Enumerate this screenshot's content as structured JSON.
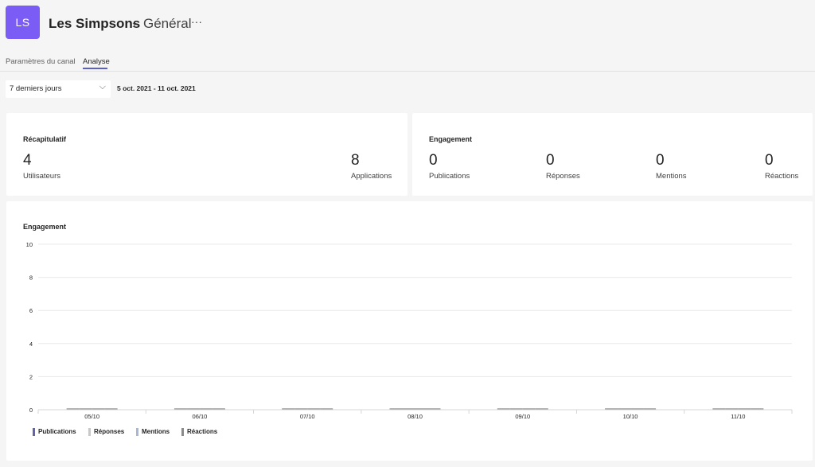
{
  "header": {
    "avatar_initials": "LS",
    "avatar_color": "#7b5cf5",
    "team_name": "Les Simpsons",
    "separator": "›",
    "channel_name": "Général",
    "more": "···"
  },
  "tabs": [
    {
      "label": "Paramètres du canal",
      "active": false
    },
    {
      "label": "Analyse",
      "active": true
    }
  ],
  "accent_color": "#5b5fc7",
  "filter": {
    "period": "7 derniers jours",
    "date_range": "5 oct. 2021 - 11 oct. 2021"
  },
  "summary": {
    "title": "Récapitulatif",
    "stats": [
      {
        "value": "4",
        "label": "Utilisateurs"
      },
      {
        "value": "8",
        "label": "Applications"
      }
    ]
  },
  "engagement": {
    "title": "Engagement",
    "stats": [
      {
        "value": "0",
        "label": "Publications"
      },
      {
        "value": "0",
        "label": "Réponses"
      },
      {
        "value": "0",
        "label": "Mentions"
      },
      {
        "value": "0",
        "label": "Réactions"
      }
    ]
  },
  "chart_section": {
    "title": "Engagement"
  },
  "chart_data": {
    "type": "bar",
    "categories": [
      "05/10",
      "06/10",
      "07/10",
      "08/10",
      "09/10",
      "10/10",
      "11/10"
    ],
    "series": [
      {
        "name": "Publications",
        "color": "#6264a7",
        "values": [
          0,
          0,
          0,
          0,
          0,
          0,
          0
        ]
      },
      {
        "name": "Réponses",
        "color": "#c8c8c8",
        "values": [
          0,
          0,
          0,
          0,
          0,
          0,
          0
        ]
      },
      {
        "name": "Mentions",
        "color": "#a6b8d6",
        "values": [
          0,
          0,
          0,
          0,
          0,
          0,
          0
        ]
      },
      {
        "name": "Réactions",
        "color": "#8a8a8a",
        "values": [
          0,
          0,
          0,
          0,
          0,
          0,
          0
        ]
      }
    ],
    "yticks": [
      0,
      2,
      4,
      6,
      8,
      10
    ],
    "ylim": [
      0,
      10
    ],
    "grid": true,
    "legend": "bottom-left"
  }
}
